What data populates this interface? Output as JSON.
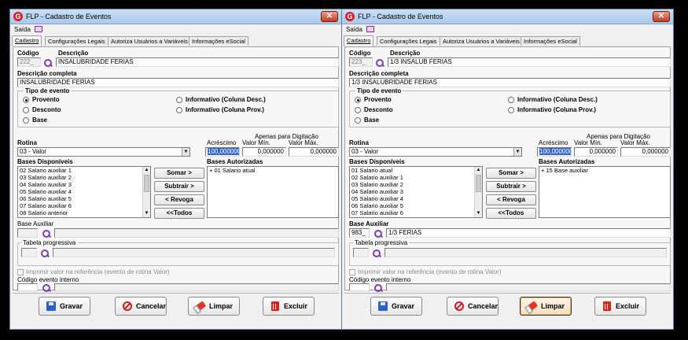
{
  "window_title": "FLP - Cadastro de Eventos",
  "close_glyph": "✕",
  "menu": {
    "saida": "Saída"
  },
  "tabs": [
    "Cadastro",
    "Configurações Legais",
    "Autoriza Usuários a Variáveis",
    "Informações eSocial"
  ],
  "labels": {
    "codigo": "Código",
    "descricao": "Descrição",
    "descricao_completa": "Descrição completa",
    "tipo_evento": "Tipo de evento",
    "proventos": "Provento",
    "desconto": "Desconto",
    "base": "Base",
    "info_desc": "Informativo (Coluna Desc.)",
    "info_prov": "Informativo (Coluna Prov.)",
    "rotina": "Rotina",
    "acrescimo": "Acréscimo",
    "apenas_digitacao": "Apenas para Digitação",
    "valor_min": "Valor Mín.",
    "valor_max": "Valor Máx.",
    "bases_disponiveis": "Bases Disponíveis",
    "bases_autorizadas": "Bases Autorizadas",
    "base_auxiliar": "Base Auxiliar",
    "tabela_progressiva": "Tabela progressiva",
    "imprimir_valor": "Imprimir valor na referência (evento de rotina Valor)",
    "codigo_evento_interno": "Código evento interno"
  },
  "side_buttons": {
    "somar": "Somar >",
    "subtrair": "Subtrair >",
    "revoga": "< Revoga",
    "todos": "<<Todos"
  },
  "bottom_buttons": {
    "gravar": "Gravar",
    "cancelar": "Cancelar",
    "limpar": "Limpar",
    "excluir": "Excluir"
  },
  "left": {
    "codigo": "222_",
    "descricao": "INSALUBRIDADE FERIAS",
    "descricao_completa": "INSALUBRIDADE FERIAS",
    "rotina": "03 - Valor",
    "acrescimo": "100,000000",
    "valor_min": "0,000000",
    "valor_max": "0,000000",
    "bases_disponiveis": [
      "02 Salario auxiliar 1",
      "03 Salario auxiliar 2",
      "04 Salario auxiliar 3",
      "05 Salario auxiliar 4",
      "06 Salario auxiliar 5",
      "07 Salario auxiliar 6",
      "08 Salario anterior"
    ],
    "bases_autorizadas": [
      "+ 01 Salario atual"
    ],
    "base_auxiliar_codigo": "",
    "base_auxiliar_desc": "",
    "codigo_evento_interno": "___"
  },
  "right": {
    "codigo": "223_",
    "descricao": "1/3 INSALUB FERIAS",
    "descricao_completa": "1/3 INSALUBRIDADE FERIAS",
    "rotina": "03 - Valor",
    "acrescimo": "100,000000",
    "valor_min": "0,000000",
    "valor_max": "0,000000",
    "bases_disponiveis": [
      "01 Salario atual",
      "02 Salario auxiliar 1",
      "03 Salario auxiliar 2",
      "04 Salario auxiliar 3",
      "05 Salario auxiliar 4",
      "06 Salario auxiliar 5",
      "07 Salario auxiliar 6"
    ],
    "bases_autorizadas": [
      "+ 15 Base auxiliar"
    ],
    "base_auxiliar_codigo": "983_",
    "base_auxiliar_desc": "1/3 FERIAS",
    "codigo_evento_interno": "___"
  },
  "colors": {
    "title_start": "#c9dff5",
    "title_end": "#a9c8ea",
    "close": "#c23b22",
    "logo": "#d61f26",
    "accent_purple": "#7b3fb0",
    "selection": "#3366cc"
  }
}
